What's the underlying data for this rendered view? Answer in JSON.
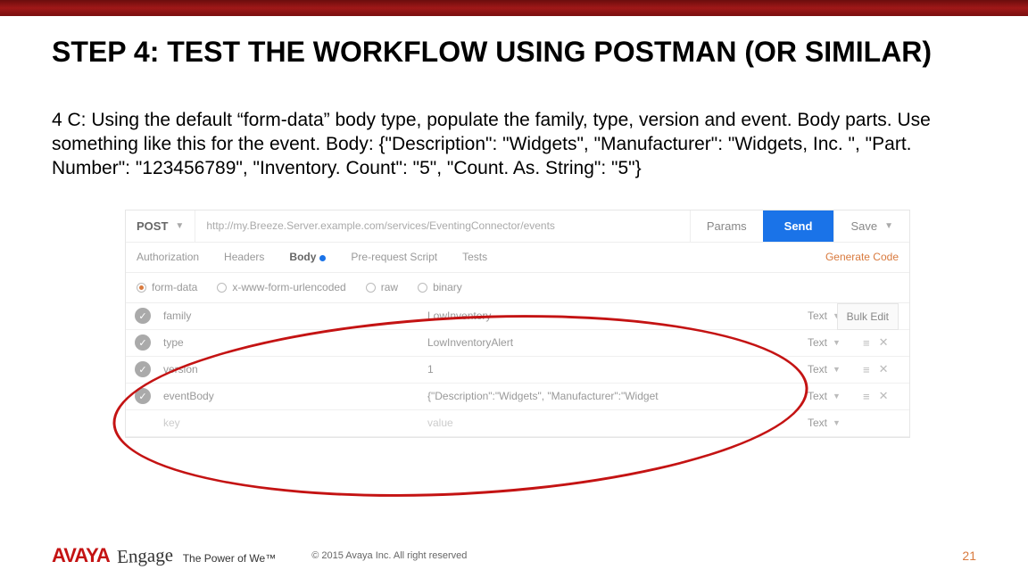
{
  "slide": {
    "title": "STEP 4: TEST THE WORKFLOW USING POSTMAN (OR SIMILAR)",
    "instruction": "4 C: Using the default “form-data” body type, populate the family, type, version and event. Body parts. Use something like this for the event. Body: {\"Description\": \"Widgets\", \"Manufacturer\": \"Widgets, Inc. \", \"Part. Number\": \"123456789\", \"Inventory. Count\": \"5\", \"Count. As. String\": \"5\"}"
  },
  "postman": {
    "method": "POST",
    "url": "http://my.Breeze.Server.example.com/services/EventingConnector/events",
    "params": "Params",
    "send": "Send",
    "save": "Save",
    "tabs": {
      "auth": "Authorization",
      "headers": "Headers",
      "body": "Body",
      "prereq": "Pre-request Script",
      "tests": "Tests"
    },
    "gencode": "Generate Code",
    "bodyTypes": {
      "formdata": "form-data",
      "urlencoded": "x-www-form-urlencoded",
      "raw": "raw",
      "binary": "binary"
    },
    "rows": [
      {
        "key": "family",
        "value": "LowInventory",
        "type": "Text"
      },
      {
        "key": "type",
        "value": "LowInventoryAlert",
        "type": "Text"
      },
      {
        "key": "version",
        "value": "1",
        "type": "Text"
      },
      {
        "key": "eventBody",
        "value": "{\"Description\":\"Widgets\", \"Manufacturer\":\"Widget",
        "type": "Text"
      }
    ],
    "emptyRow": {
      "key": "key",
      "value": "value",
      "type": "Text"
    },
    "bulkedit": "Bulk Edit"
  },
  "footer": {
    "avaya": "AVAYA",
    "engage": "Engage",
    "power": "The Power of We™",
    "copyright": "© 2015 Avaya Inc. All right reserved",
    "page": "21"
  }
}
